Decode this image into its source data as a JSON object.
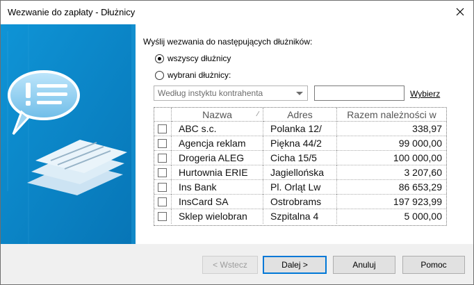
{
  "window": {
    "title": "Wezwanie do zapłaty - Dłużnicy"
  },
  "form": {
    "heading": "Wyślij wezwania do następujących dłużników:",
    "radio_all": "wszyscy dłużnicy",
    "radio_selected": "wybrani dłużnicy:",
    "selected_option": "all",
    "combo_value": "Według instyktu kontrahenta",
    "search_value": "",
    "choose_link": "Wybierz"
  },
  "table": {
    "columns": [
      "Nazwa",
      "Adres",
      "Razem należności w"
    ],
    "rows": [
      {
        "checked": false,
        "name": "ABC s.c.",
        "address": "Polanka  12/",
        "amount": "338,97"
      },
      {
        "checked": false,
        "name": "Agencja reklam",
        "address": "Piękna  44/2",
        "amount": "99 000,00"
      },
      {
        "checked": false,
        "name": "Drogeria ALEG",
        "address": "Cicha  15/5",
        "amount": "100 000,00"
      },
      {
        "checked": false,
        "name": "Hurtownia ERIE",
        "address": "Jagiellońska",
        "amount": "3 207,60"
      },
      {
        "checked": false,
        "name": "Ins Bank",
        "address": "Pl. Orląt Lw",
        "amount": "86 653,29"
      },
      {
        "checked": false,
        "name": "InsCard SA",
        "address": "Ostrobrams",
        "amount": "197 923,99"
      },
      {
        "checked": false,
        "name": "Sklep wielobran",
        "address": "Szpitalna  4",
        "amount": "5 000,00"
      }
    ]
  },
  "buttons": {
    "back": "< Wstecz",
    "next": "Dalej >",
    "cancel": "Anuluj",
    "help": "Pomoc"
  },
  "icons": {
    "close": "close-icon",
    "sidebar_art": "speech-bubble-documents-icon",
    "combo_arrow": "chevron-down-icon"
  },
  "colors": {
    "sidebar": "#0b86c8",
    "primary_border": "#0078d7"
  }
}
